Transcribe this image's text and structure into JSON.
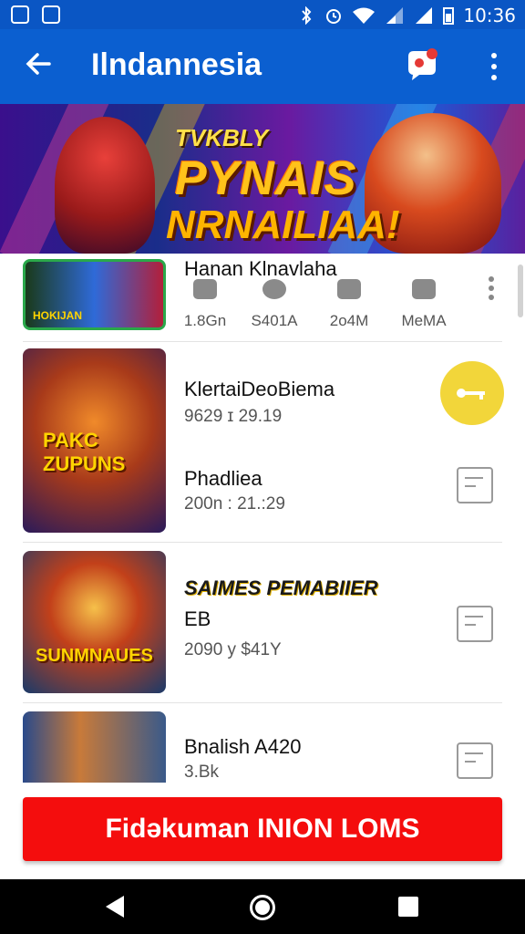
{
  "status_bar": {
    "time": "10:36"
  },
  "app_bar": {
    "title": "Ilndannesia"
  },
  "banner": {
    "line1": "TVKBLY",
    "line2": "PYNAIS",
    "line3": "NRNAILIAA!"
  },
  "list": {
    "row1": {
      "title": "Hanan Klnavlaha",
      "thumb_text": "HOKIJAN",
      "stats": [
        {
          "icon": "gear-icon",
          "value": "1.8Gn"
        },
        {
          "icon": "check-icon",
          "value": "S401A"
        },
        {
          "icon": "book-icon",
          "value": "2o4M"
        },
        {
          "icon": "tag-icon",
          "value": "MeMA"
        }
      ]
    },
    "row2": {
      "title": "KlertaiDeoBiema",
      "meta": "9629 ɪ  29.19",
      "subtitle": "Phadliea",
      "submeta": "200n : 21.:29",
      "thumb_text": "PAKC ZUPUNS"
    },
    "row3": {
      "title": "SAIMES PEMABIIER",
      "subtitle": "EB",
      "meta": "2090 y  $41Y",
      "thumb_text": "SUNMNAUES"
    },
    "row4": {
      "title": "Bnalish A420",
      "meta": "3.Bk"
    }
  },
  "cta": {
    "label": "Fidəkuman INION LOMS"
  },
  "colors": {
    "appbar": "#0b5fd0",
    "cta": "#f40d0d",
    "accent_yellow": "#f2d63a"
  }
}
